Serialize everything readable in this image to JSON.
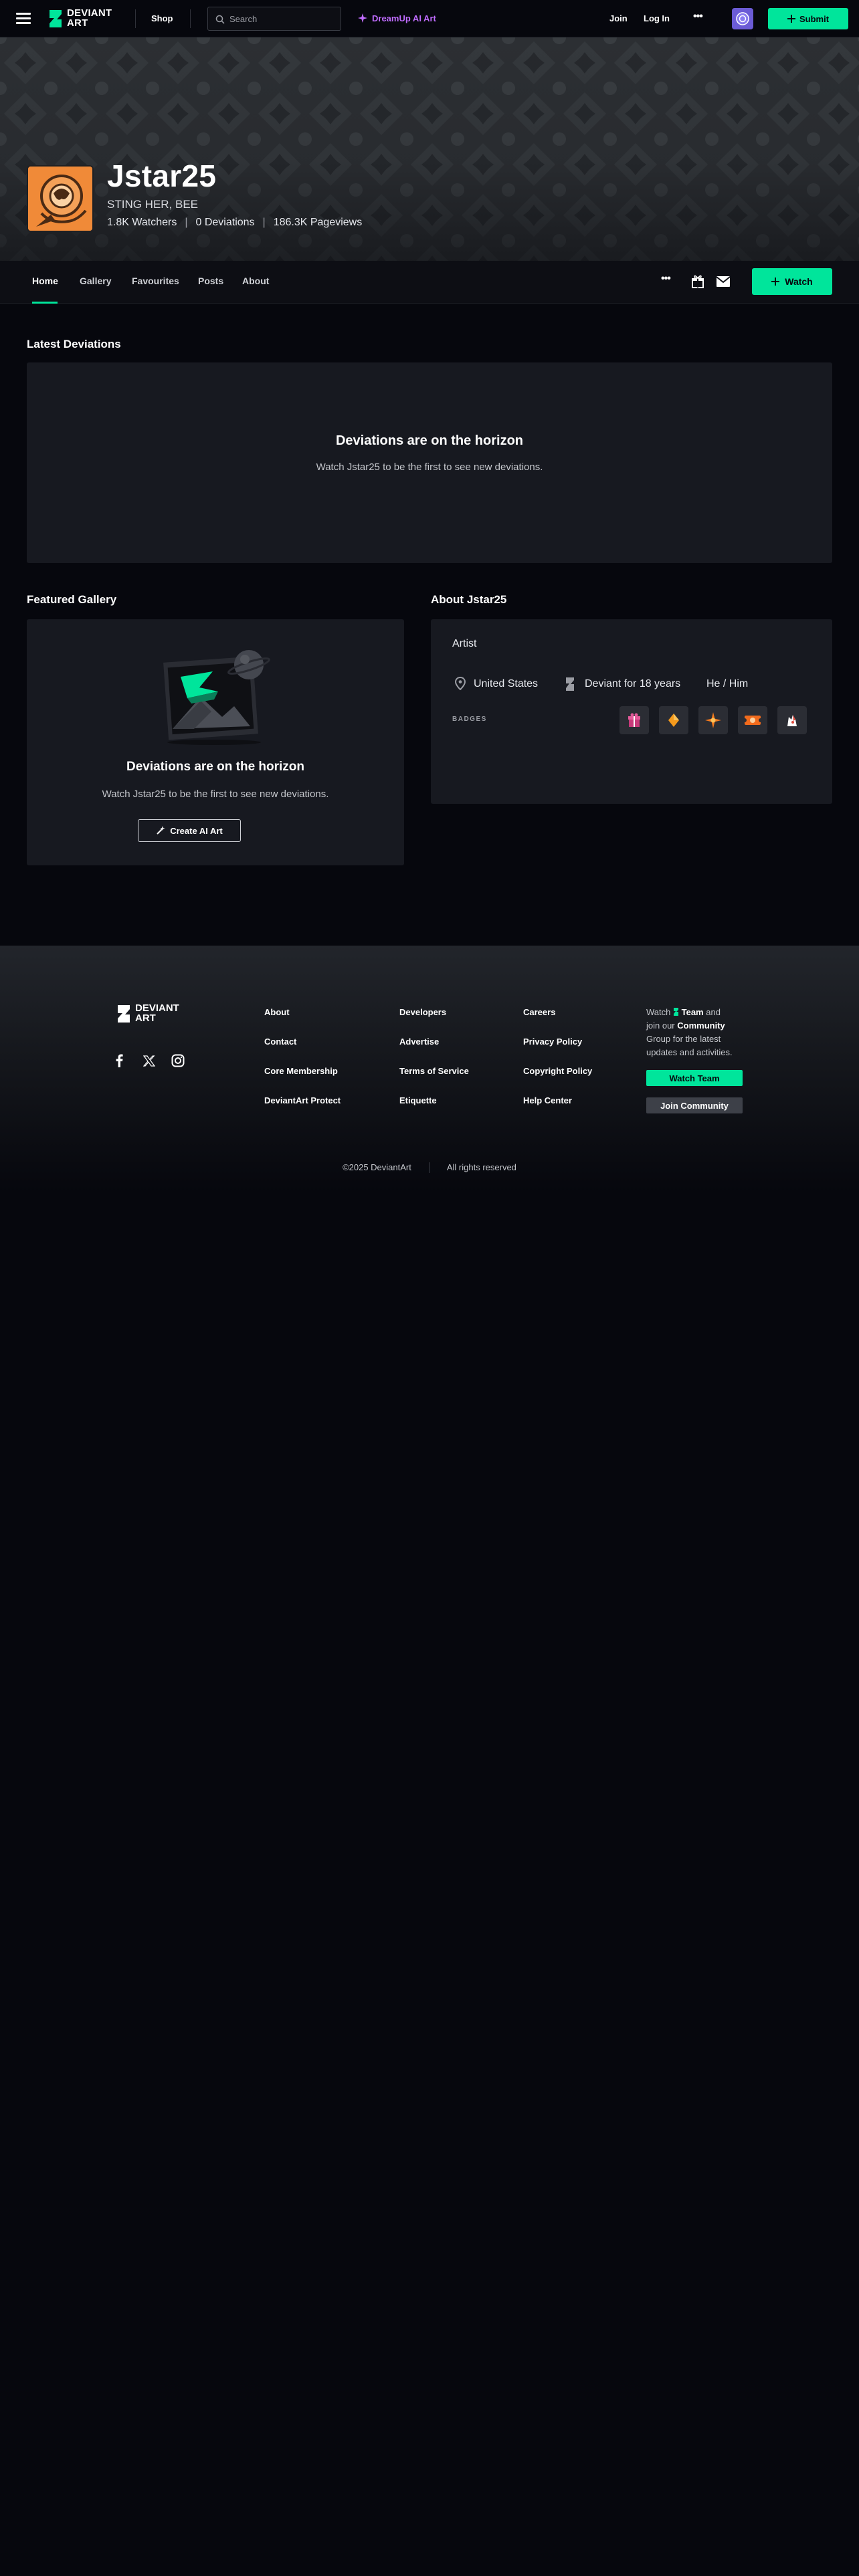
{
  "topbar": {
    "logo_line1": "DEVIANT",
    "logo_line2": "ART",
    "shop": "Shop",
    "search_placeholder": "Search",
    "dreamup": "DreamUp AI Art",
    "join": "Join",
    "login": "Log In",
    "more": "•••",
    "submit": "Submit"
  },
  "profile": {
    "username": "Jstar25",
    "tagline": "STING HER, BEE",
    "watchers": "1.8K Watchers",
    "deviations": "0 Deviations",
    "pageviews": "186.3K Pageviews",
    "stat_sep": "|"
  },
  "tabs": [
    {
      "label": "Home",
      "active": true
    },
    {
      "label": "Gallery"
    },
    {
      "label": "Favourites"
    },
    {
      "label": "Posts"
    },
    {
      "label": "About"
    }
  ],
  "tab_actions": {
    "more": "•••",
    "watch": "Watch"
  },
  "latest": {
    "title": "Latest Deviations",
    "empty_title": "Deviations are on the horizon",
    "empty_sub": "Watch Jstar25 to be the first to see new deviations."
  },
  "featured": {
    "title": "Featured Gallery",
    "empty_title": "Deviations are on the horizon",
    "empty_sub": "Watch Jstar25 to be the first to see new deviations.",
    "button": "Create AI Art"
  },
  "about": {
    "title": "About Jstar25",
    "role": "Artist",
    "location": "United States",
    "member": "Deviant for 18 years",
    "pronouns": "He / Him",
    "badges_label": "BADGES"
  },
  "footer": {
    "logo_line1": "DEVIANT",
    "logo_line2": "ART",
    "col1": [
      "About",
      "Contact",
      "Core Membership",
      "DeviantArt Protect"
    ],
    "col2": [
      "Developers",
      "Advertise",
      "Terms of Service",
      "Etiquette"
    ],
    "col3": [
      "Careers",
      "Privacy Policy",
      "Copyright Policy",
      "Help Center"
    ],
    "promo_watch": "Watch",
    "promo_team": "Team",
    "promo_and": "and",
    "promo_join": "join our",
    "promo_community": "Community",
    "promo_rest": "Group for the latest updates and activities.",
    "watch_team": "Watch Team",
    "join_community": "Join Community",
    "copyright": "©2025 DeviantArt",
    "rights": "All rights reserved"
  },
  "colors": {
    "accent": "#00e59b",
    "dreamup": "#c06cff",
    "background": "#06070d",
    "panel": "#171920",
    "avatar_orange": "#f08a38"
  }
}
